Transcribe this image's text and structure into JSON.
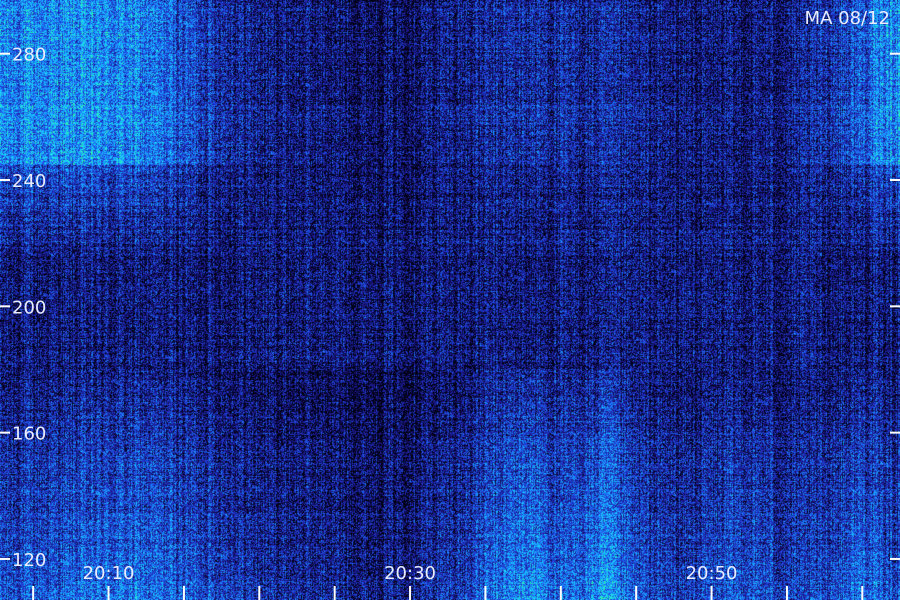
{
  "chart_data": {
    "type": "heatmap",
    "title": "MA 08/12",
    "xlabel": "",
    "ylabel": "",
    "y_ticks": [
      120,
      160,
      200,
      240,
      280
    ],
    "y_range": [
      107,
      297
    ],
    "x_ticks": [
      "20:10",
      "20:30",
      "20:50"
    ],
    "x_range_minutes": [
      2.8,
      62.5
    ],
    "x_tick_minutes": [
      10,
      30,
      50
    ],
    "minor_tick_minutes": [
      5,
      10,
      15,
      20,
      25,
      30,
      35,
      40,
      45,
      50,
      55,
      60
    ],
    "colormap": [
      "#000010",
      "#1a1480",
      "#1f3fd8",
      "#1b8fff",
      "#19d7ff",
      "#35ff8a"
    ],
    "intensity_profile": {
      "time_minutes": [
        3,
        8,
        12,
        17,
        20,
        24,
        28,
        33,
        36,
        38,
        40,
        43,
        45,
        48,
        52,
        56,
        60,
        62
      ],
      "low_band_level": [
        0.55,
        0.65,
        0.7,
        0.55,
        0.4,
        0.35,
        0.3,
        0.45,
        0.7,
        0.85,
        0.6,
        0.85,
        0.55,
        0.45,
        0.6,
        0.45,
        0.7,
        0.55
      ],
      "high_band_level": [
        0.75,
        0.8,
        0.75,
        0.45,
        0.3,
        0.25,
        0.2,
        0.3,
        0.35,
        0.4,
        0.35,
        0.35,
        0.3,
        0.25,
        0.25,
        0.3,
        0.6,
        0.8
      ]
    },
    "grid": false,
    "legend": "none"
  }
}
